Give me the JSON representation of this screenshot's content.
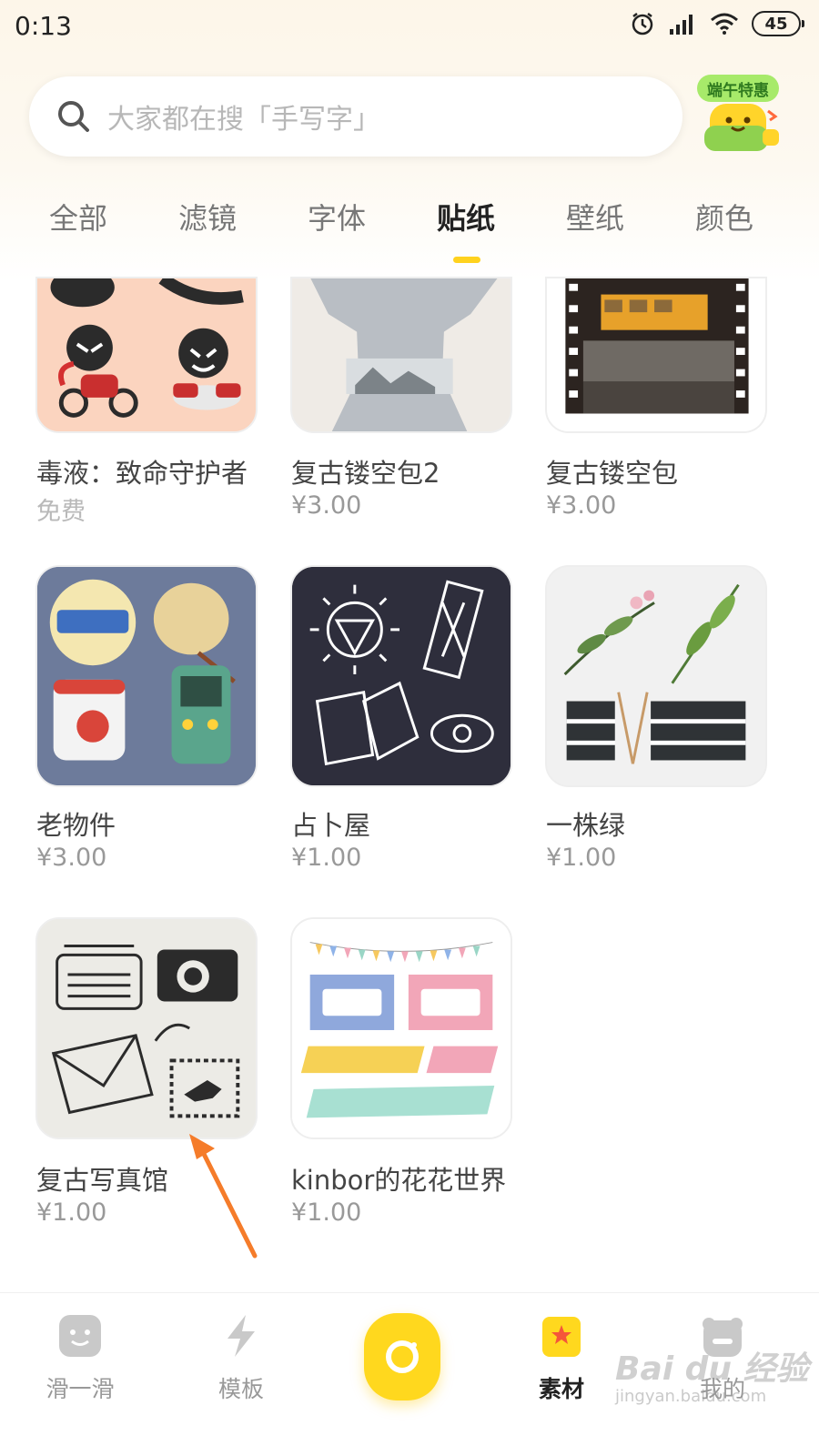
{
  "status_bar": {
    "time": "0:13",
    "battery": "45"
  },
  "search": {
    "placeholder": "大家都在搜「手写字」"
  },
  "promo": {
    "label": "端午特惠"
  },
  "tabs": [
    {
      "label": "全部"
    },
    {
      "label": "滤镜"
    },
    {
      "label": "字体"
    },
    {
      "label": "贴纸",
      "active": true
    },
    {
      "label": "壁纸"
    },
    {
      "label": "颜色"
    }
  ],
  "stickers": [
    {
      "title": "毒液：致命守护者",
      "price": "免费"
    },
    {
      "title": "复古镂空包2",
      "price": "¥3.00"
    },
    {
      "title": "复古镂空包",
      "price": "¥3.00"
    },
    {
      "title": "老物件",
      "price": "¥3.00"
    },
    {
      "title": "占卜屋",
      "price": "¥1.00"
    },
    {
      "title": "一株绿",
      "price": "¥1.00"
    },
    {
      "title": "复古写真馆",
      "price": "¥1.00"
    },
    {
      "title": "kinbor的花花世界",
      "price": "¥1.00"
    }
  ],
  "bottom_nav": {
    "items": [
      {
        "label": "滑一滑",
        "icon": "face-icon"
      },
      {
        "label": "模板",
        "icon": "lightning-icon"
      },
      {
        "label": "",
        "icon": "camera-icon"
      },
      {
        "label": "素材",
        "icon": "star-bag-icon",
        "active": true
      },
      {
        "label": "我的",
        "icon": "bear-icon"
      }
    ]
  },
  "watermark": {
    "brand": "Bai du 经验",
    "url": "jingyan.baidu.com"
  },
  "colors": {
    "accent": "#ffd81e",
    "tab_active": "#222222",
    "tab_inactive": "#777777"
  }
}
